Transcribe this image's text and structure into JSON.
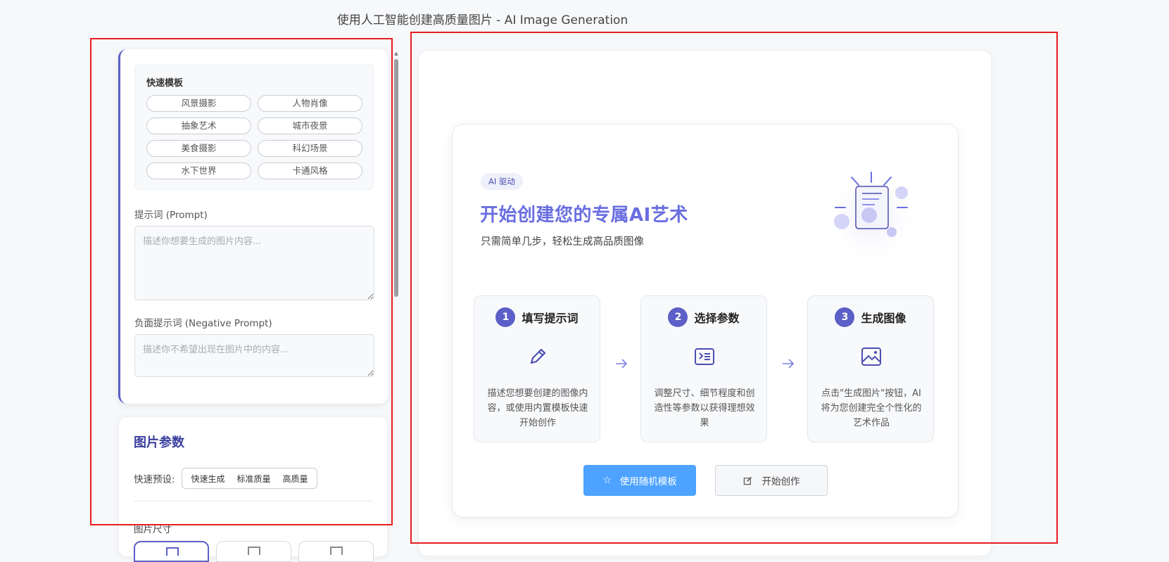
{
  "page_title": "使用人工智能创建高质量图片 - AI Image Generation",
  "templates": {
    "title": "快速模板",
    "items": [
      "风景摄影",
      "人物肖像",
      "抽象艺术",
      "城市夜景",
      "美食摄影",
      "科幻场景",
      "水下世界",
      "卡通风格"
    ]
  },
  "prompt": {
    "label": "提示词 (Prompt)",
    "placeholder": "描述你想要生成的图片内容..."
  },
  "negative_prompt": {
    "label": "负面提示词 (Negative Prompt)",
    "placeholder": "描述你不希望出现在图片中的内容..."
  },
  "params": {
    "title": "图片参数",
    "preset_label": "快速预设:",
    "presets": [
      "快速生成",
      "标准质量",
      "高质量"
    ],
    "size_label": "图片尺寸"
  },
  "welcome": {
    "badge": "AI 驱动",
    "title": "开始创建您的专属AI艺术",
    "subtitle": "只需简单几步，轻松生成高品质图像",
    "steps": [
      {
        "num": "1",
        "title": "填写提示词",
        "desc": "描述您想要创建的图像内容，或使用内置模板快速开始创作",
        "icon": "pencil-icon"
      },
      {
        "num": "2",
        "title": "选择参数",
        "desc": "调整尺寸、细节程度和创造性等参数以获得理想效果",
        "icon": "terminal-icon"
      },
      {
        "num": "3",
        "title": "生成图像",
        "desc": "点击\"生成图片\"按钮，AI将为您创建完全个性化的艺术作品",
        "icon": "image-icon"
      }
    ],
    "random_button": "使用随机模板",
    "start_button": "开始创作"
  },
  "colors": {
    "accent": "#5b5fc7",
    "primary_button": "#4da3ff",
    "annotation_outline": "#e61e1e"
  }
}
